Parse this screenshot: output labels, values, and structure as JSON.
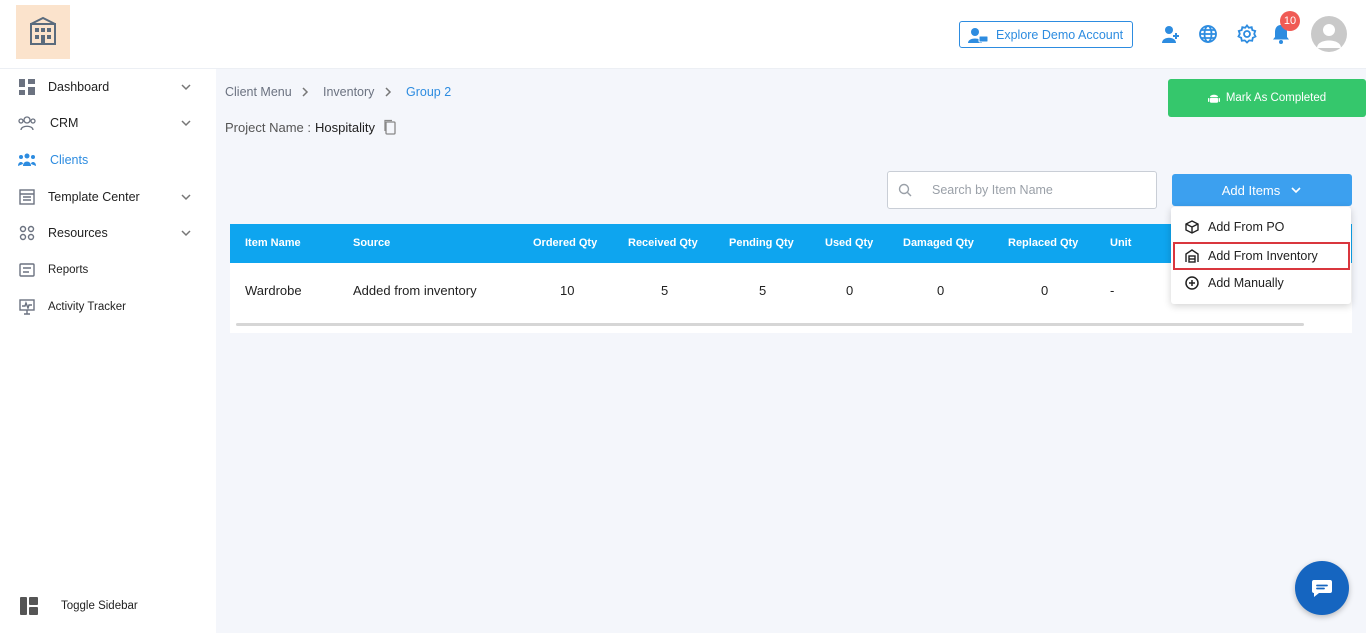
{
  "header": {
    "demo_label": "Explore Demo Account",
    "notification_count": "10"
  },
  "sidebar": {
    "items": [
      {
        "label": "Dashboard",
        "icon": "grid-icon",
        "expandable": true
      },
      {
        "label": "CRM",
        "icon": "crm-users-icon",
        "expandable": true
      },
      {
        "label": "Clients",
        "icon": "clients-icon",
        "expandable": false,
        "active": true
      },
      {
        "label": "Template Center",
        "icon": "template-icon",
        "expandable": true
      },
      {
        "label": "Resources",
        "icon": "resources-icon",
        "expandable": true
      },
      {
        "label": "Reports",
        "icon": "reports-icon",
        "expandable": false
      },
      {
        "label": "Activity Tracker",
        "icon": "monitor-icon",
        "expandable": false
      }
    ],
    "toggle_label": "Toggle Sidebar"
  },
  "breadcrumb": [
    "Client Menu",
    "Inventory",
    "Group 2"
  ],
  "project": {
    "label": "Project Name :",
    "value": "Hospitality"
  },
  "mark_completed_label": "Mark As Completed",
  "search": {
    "placeholder": "Search by Item Name",
    "value": ""
  },
  "add_items_label": "Add Items",
  "add_menu": [
    {
      "label": "Add From PO",
      "icon": "cube-check-icon"
    },
    {
      "label": "Add From Inventory",
      "icon": "warehouse-icon",
      "highlighted": true
    },
    {
      "label": "Add Manually",
      "icon": "plus-circle-icon"
    }
  ],
  "table": {
    "columns": [
      "Item Name",
      "Source",
      "Ordered Qty",
      "Received Qty",
      "Pending Qty",
      "Used Qty",
      "Damaged Qty",
      "Replaced Qty",
      "Unit"
    ],
    "rows": [
      [
        "Wardrobe",
        "Added from inventory",
        "10",
        "5",
        "5",
        "0",
        "0",
        "0",
        "-"
      ]
    ]
  },
  "colors": {
    "accent": "#2d8ce0",
    "table_header": "#0ea5ef",
    "success": "#35c76c",
    "badge": "#f05b55",
    "highlight_border": "#d9363e"
  }
}
